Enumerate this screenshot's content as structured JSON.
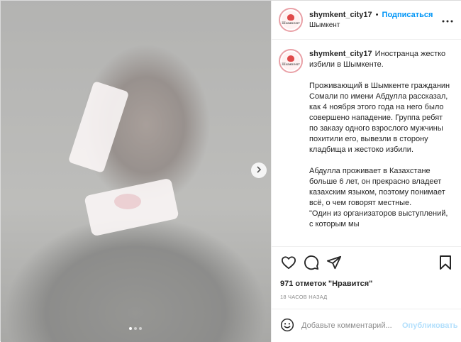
{
  "post": {
    "username": "shymkent_city17",
    "separator": "•",
    "follow_label": "Подписаться",
    "location": "Шымкент",
    "avatar_text": "Шымкент",
    "caption_paragraphs": [
      "Иностранца жестко избили в Шымкенте.",
      "Проживающий в Шымкенте гражданин Сомали по имени Абдулла рассказал, как 4 ноября этого года на него было совершено нападение. Группа ребят по заказу одного взрослого мужчины похитили его, вывезли в сторону кладбища и жестоко избили.",
      "Абдулла проживает в Казахстане больше 6 лет, он прекрасно владеет казахским языком, поэтому понимает всё, о чем говорят местные.\n\"Один из организаторов выступлений, с которым мы"
    ],
    "likes_text": "971 отметок \"Нравится\"",
    "time_text": "18 ЧАСОВ НАЗАД"
  },
  "comment": {
    "placeholder": "Добавьте комментарий...",
    "post_label": "Опубликовать"
  },
  "media": {
    "slide_count": 3,
    "active_slide": 1
  },
  "icons": {
    "like": "heart-icon",
    "comment": "comment-icon",
    "share": "share-icon",
    "save": "bookmark-icon",
    "emoji": "emoji-icon",
    "more": "more-icon",
    "next": "chevron-right-icon"
  },
  "colors": {
    "accent": "#0095f6",
    "post_disabled": "#b2dffc",
    "muted": "#8e8e8e"
  }
}
